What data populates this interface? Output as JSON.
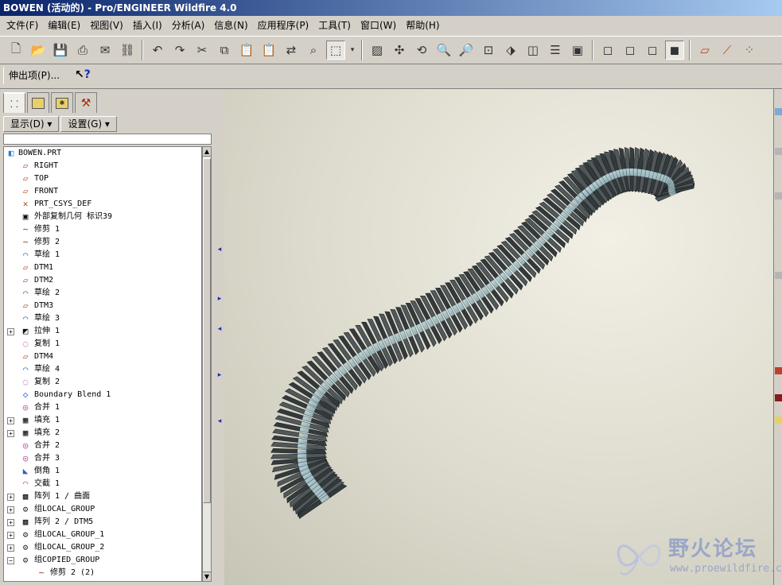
{
  "window": {
    "title": "BOWEN (活动的) - Pro/ENGINEER Wildfire 4.0"
  },
  "menubar": [
    "文件(F)",
    "编辑(E)",
    "视图(V)",
    "插入(I)",
    "分析(A)",
    "信息(N)",
    "应用程序(P)",
    "工具(T)",
    "窗口(W)",
    "帮助(H)"
  ],
  "feature_bar": {
    "menu_label": "伸出项(P)...",
    "help_glyph": "?"
  },
  "model_tree": {
    "show_menu": "显示(D) ▾",
    "settings_menu": "设置(G) ▾",
    "root": "BOWEN.PRT",
    "items": [
      {
        "label": "RIGHT",
        "icon": "datum-plane-icon"
      },
      {
        "label": "TOP",
        "icon": "datum-plane-icon"
      },
      {
        "label": "FRONT",
        "icon": "datum-plane-icon"
      },
      {
        "label": "PRT_CSYS_DEF",
        "icon": "coordinate-system-icon"
      },
      {
        "label": "外部复制几何 标识39",
        "icon": "external-copy-geometry-icon"
      },
      {
        "label": "修剪 1",
        "icon": "trim-curve-icon"
      },
      {
        "label": "修剪 2",
        "icon": "trim-curve-icon"
      },
      {
        "label": "草绘 1",
        "icon": "sketch-icon"
      },
      {
        "label": "DTM1",
        "icon": "datum-plane-icon"
      },
      {
        "label": "DTM2",
        "icon": "datum-plane-icon"
      },
      {
        "label": "草绘 2",
        "icon": "sketch-icon"
      },
      {
        "label": "DTM3",
        "icon": "datum-plane-icon"
      },
      {
        "label": "草绘 3",
        "icon": "sketch-icon"
      },
      {
        "label": "拉伸 1",
        "icon": "extrude-icon",
        "expandable": true
      },
      {
        "label": "复制 1",
        "icon": "copy-surface-icon"
      },
      {
        "label": "DTM4",
        "icon": "datum-plane-icon"
      },
      {
        "label": "草绘 4",
        "icon": "sketch-icon"
      },
      {
        "label": "复制 2",
        "icon": "copy-surface-icon"
      },
      {
        "label": "Boundary Blend 1",
        "icon": "boundary-blend-icon"
      },
      {
        "label": "合并 1",
        "icon": "merge-icon"
      },
      {
        "label": "填充 1",
        "icon": "fill-icon",
        "expandable": true
      },
      {
        "label": "填充 2",
        "icon": "fill-icon",
        "expandable": true
      },
      {
        "label": "合并 2",
        "icon": "merge-icon"
      },
      {
        "label": "合并 3",
        "icon": "merge-icon"
      },
      {
        "label": "倒角 1",
        "icon": "chamfer-icon"
      },
      {
        "label": "交截 1",
        "icon": "intersect-icon"
      },
      {
        "label": "阵列 1 / 曲面",
        "icon": "pattern-icon",
        "expandable": true
      },
      {
        "label": "组LOCAL_GROUP",
        "icon": "group-icon",
        "expandable": true
      },
      {
        "label": "阵列 2 / DTM5",
        "icon": "pattern-icon",
        "expandable": true
      },
      {
        "label": "组LOCAL_GROUP_1",
        "icon": "group-icon",
        "expandable": true
      },
      {
        "label": "组LOCAL_GROUP_2",
        "icon": "group-icon",
        "expandable": true
      },
      {
        "label": "组COPIED_GROUP",
        "icon": "copied-group-icon",
        "expandable": true,
        "expanded": true
      },
      {
        "label": "修剪 2 (2)",
        "icon": "trim-curve-icon",
        "child": true
      }
    ]
  },
  "watermark": {
    "title": "野火论坛",
    "url": "www.proewildfire.cn"
  },
  "colors": {
    "title_gradient_start": "#0a246a",
    "title_gradient_end": "#a6caf0",
    "chrome": "#d4d0c8",
    "viewport_bg": "#e4e2d6",
    "model_dark": "#343a3c",
    "model_band": "#a9c5cb"
  }
}
